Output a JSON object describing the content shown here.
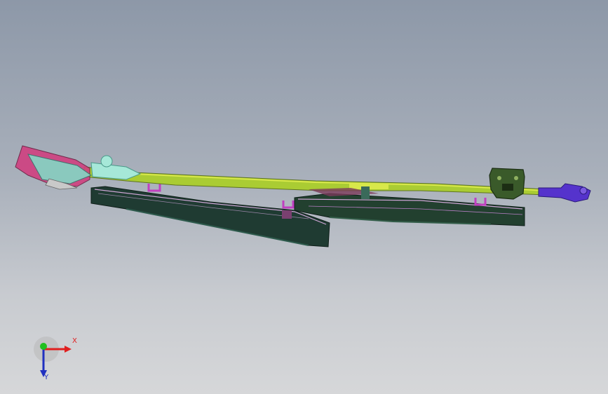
{
  "viewport": {
    "background_top": "#8d98a8",
    "background_bottom": "#d6d7d9"
  },
  "model": {
    "description_icon": "wiper-assembly-model",
    "colors": {
      "arm": "#aacc33",
      "arm_light": "#d8e84a",
      "blade_dark": "#1f3b32",
      "blade_edge": "#cfa6d6",
      "clip_magenta": "#c040c0",
      "pivot_cap": "#3a5a2a",
      "end_connector": "#5533cc",
      "mechanism_teal": "#7fe0c8",
      "mechanism_pink": "#d04080"
    }
  },
  "triad": {
    "x_label": "X",
    "y_label": "Y",
    "x_color": "#e02020",
    "y_color": "#20c020",
    "z_color": "#2030c0"
  }
}
